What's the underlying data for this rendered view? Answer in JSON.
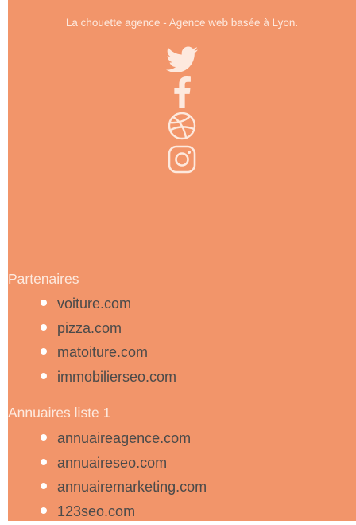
{
  "footer": {
    "tagline": "La chouette agence - Agence web basée à Lyon.",
    "social_icons": [
      "twitter-icon",
      "facebook-icon",
      "dribbble-icon",
      "instagram-icon"
    ]
  },
  "partners": {
    "title": "Partenaires",
    "items": [
      "voiture.com",
      "pizza.com",
      "matoiture.com",
      "immobilierseo.com"
    ]
  },
  "directories": {
    "title": "Annuaires liste 1",
    "items": [
      "annuaireagence.com",
      "annuaireseo.com",
      "annuairemarketing.com",
      "123seo.com"
    ]
  },
  "colors": {
    "background": "#f2956a",
    "light_text": "#fde9de",
    "link_text": "#4a4a4a"
  }
}
